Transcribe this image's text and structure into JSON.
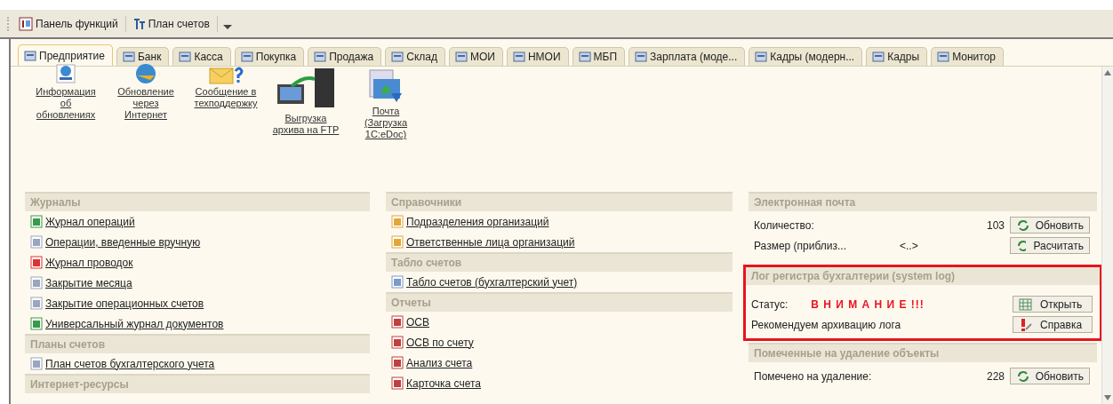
{
  "toolbar": {
    "items": [
      {
        "label": "Панель функций",
        "kind": "panel"
      },
      {
        "label": "План счетов",
        "kind": "chart"
      }
    ]
  },
  "tabs": [
    {
      "label": "Предприятие",
      "selected": true
    },
    {
      "label": "Банк",
      "selected": false
    },
    {
      "label": "Касса",
      "selected": false
    },
    {
      "label": "Покупка",
      "selected": false
    },
    {
      "label": "Продажа",
      "selected": false
    },
    {
      "label": "Склад",
      "selected": false
    },
    {
      "label": "МОИ",
      "selected": false
    },
    {
      "label": "НМОИ",
      "selected": false
    },
    {
      "label": "МБП",
      "selected": false
    },
    {
      "label": "Зарплата (моде...",
      "selected": false
    },
    {
      "label": "Кадры (модерн...",
      "selected": false
    },
    {
      "label": "Кадры",
      "selected": false
    },
    {
      "label": "Монитор",
      "selected": false
    }
  ],
  "quick_links": [
    {
      "label": "Информация об обновлениях",
      "kind": "www"
    },
    {
      "label": "Обновление через Интернет",
      "kind": "globe"
    },
    {
      "label": "Сообщение в техподдержку",
      "kind": "mail"
    },
    {
      "label": "Выгрузка архива на FTP",
      "kind": "server"
    },
    {
      "label": "Почта (Загрузка 1C:eDoc)",
      "kind": "folder"
    }
  ],
  "columns": [
    {
      "sections": [
        {
          "title": "Журналы",
          "items": [
            {
              "label": "Журнал операций",
              "kind": "journal"
            },
            {
              "label": "Операции, введенные вручную",
              "kind": "doc"
            },
            {
              "label": "Журнал проводок ",
              "kind": "dtkt"
            },
            {
              "label": "Закрытие месяца",
              "kind": "doc"
            },
            {
              "label": "Закрытие операционных счетов",
              "kind": "doc"
            },
            {
              "label": "Универсальный журнал документов",
              "kind": "journal"
            }
          ]
        },
        {
          "title": "Планы счетов",
          "items": [
            {
              "label": "План счетов бухгалтерского учета",
              "kind": "doc"
            }
          ]
        },
        {
          "title": "Интернет-ресурсы"
        }
      ]
    },
    {
      "sections": [
        {
          "title": "Справочники",
          "items": [
            {
              "label": "Подразделения организаций",
              "kind": "catalog"
            },
            {
              "label": "Ответственные лица организаций",
              "kind": "catalog"
            }
          ]
        },
        {
          "title": "Табло счетов",
          "items": [
            {
              "label": "Табло счетов (бухгалтерский учет)",
              "kind": "search"
            }
          ]
        },
        {
          "title": "Отчеты",
          "items": [
            {
              "label": "ОСВ",
              "kind": "report"
            },
            {
              "label": "ОСВ по счету",
              "kind": "report"
            },
            {
              "label": "Анализ счета",
              "kind": "report"
            },
            {
              "label": "Карточка счета ",
              "kind": "report"
            }
          ]
        }
      ]
    }
  ],
  "monitor": [
    {
      "title": "Электронная почта",
      "highlighted": false,
      "rows": [
        {
          "label": "Количество:",
          "value": "103",
          "kind": "number",
          "button": {
            "label": "Обновить",
            "kind": "refresh"
          }
        },
        {
          "label": "Размер (приблиз...",
          "value": "<..>",
          "kind": "mid",
          "button": {
            "label": "Расчитать",
            "kind": "refresh"
          }
        }
      ]
    },
    {
      "title": "Лог регистра бухгалтерии (system log)",
      "highlighted": true,
      "rows": [
        {
          "label": "Статус:",
          "value": "В Н И М А Н И Е !!!",
          "kind": "alert",
          "button": {
            "label": "Открыть",
            "kind": "table"
          }
        },
        {
          "label": "Рекомендуем архивацию лога",
          "kind": "plain",
          "button": {
            "label": "Справка",
            "kind": "help"
          }
        }
      ]
    },
    {
      "title": "Помеченные на удаление объекты",
      "highlighted": false,
      "rows": [
        {
          "label": "Помечено на удаление:",
          "value": "228",
          "kind": "number",
          "button": {
            "label": "Обновить",
            "kind": "refresh"
          }
        }
      ]
    }
  ]
}
